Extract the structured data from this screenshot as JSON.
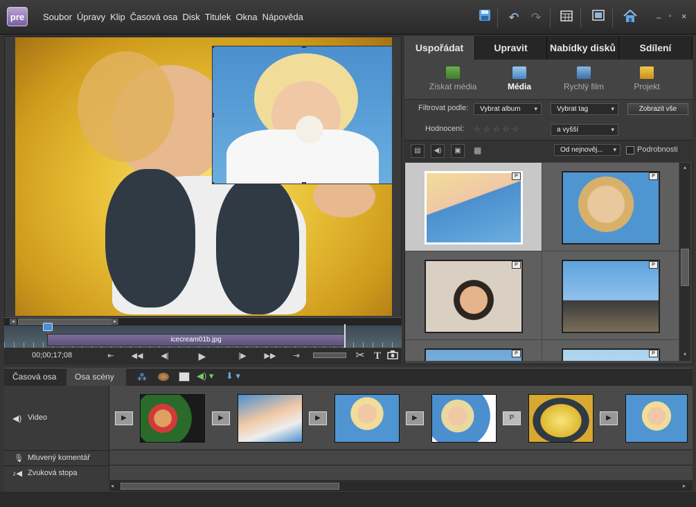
{
  "app": {
    "logo": "pre"
  },
  "menu": [
    "Soubor",
    "Úpravy",
    "Klip",
    "Časová osa",
    "Disk",
    "Titulek",
    "Okna",
    "Nápověda"
  ],
  "monitor": {
    "clip_name": "icecream01b.jpg",
    "timecode": "00;00;17;08"
  },
  "tabs": [
    {
      "label": "Uspořádat",
      "active": true
    },
    {
      "label": "Upravit"
    },
    {
      "label": "Nabídky disků"
    },
    {
      "label": "Sdílení"
    }
  ],
  "subtabs": [
    {
      "label": "Získat média"
    },
    {
      "label": "Média",
      "active": true
    },
    {
      "label": "Rychlý film"
    },
    {
      "label": "Projekt"
    }
  ],
  "filters": {
    "filter_label": "Filtrovat podle:",
    "album": "Vybrat album",
    "tag": "Vybrat tag",
    "show_all": "Zobrazit vše",
    "rating_label": "Hodnocení:",
    "rating_cmp": "a vyšší",
    "sort": "Od nejnověj...",
    "details": "Podrobnosti"
  },
  "media_badge": "P",
  "bottom": {
    "tabs": [
      {
        "label": "Časová osa"
      },
      {
        "label": "Osa scény",
        "active": true
      }
    ],
    "tracks": {
      "video": "Video",
      "narration": "Mluvený komentář",
      "soundtrack": "Zvuková stopa"
    }
  },
  "colors": {
    "accent": "#7a5ea3",
    "selection": "#ffffff",
    "background": "#353535"
  }
}
